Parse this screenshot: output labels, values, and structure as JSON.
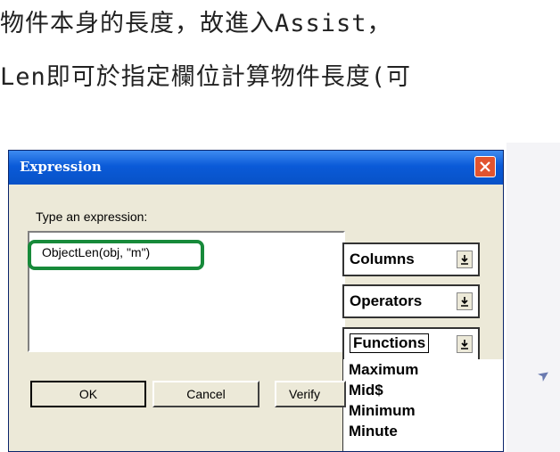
{
  "caption": {
    "line1": "物件本身的長度，故進入Assist，",
    "line2": "Len即可於指定欄位計算物件長度(可"
  },
  "dialog": {
    "title": "Expression",
    "prompt_label": "Type an expression:",
    "expression_value": "ObjectLen(obj, \"m\")",
    "dropdowns": {
      "columns": "Columns",
      "operators": "Operators",
      "functions": "Functions"
    },
    "function_list": [
      "Maximum",
      "Mid$",
      "Minimum",
      "Minute"
    ],
    "buttons": {
      "ok": "OK",
      "cancel": "Cancel",
      "verify": "Verify"
    }
  },
  "colors": {
    "titlebar": "#0a5ad8",
    "highlight": "#178a3a",
    "close_button": "#e2542f"
  },
  "icons": [
    "close-icon",
    "dropdown-arrow-icon",
    "pointer-arrow-icon"
  ]
}
